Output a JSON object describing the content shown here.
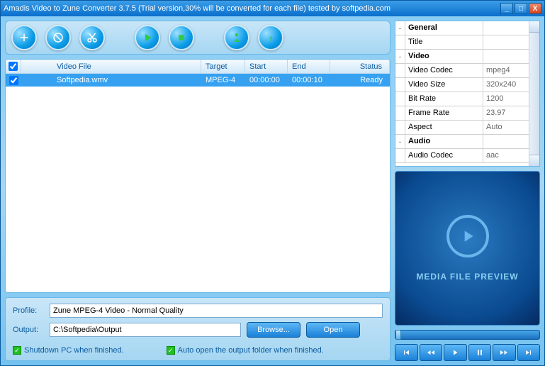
{
  "titlebar": "Amadis Video to Zune Converter 3.7.5 (Trial version,30% will be converted for each file) tested by softpedia.com",
  "list": {
    "headers": {
      "file": "Video File",
      "target": "Target",
      "start": "Start",
      "end": "End",
      "status": "Status"
    },
    "rows": [
      {
        "checked": true,
        "file": "Softpedia.wmv",
        "target": "MPEG-4",
        "start": "00:00:00",
        "end": "00:00:10",
        "status": "Ready"
      }
    ]
  },
  "bottom": {
    "profile_label": "Profile:",
    "profile_value": "Zune MPEG-4 Video - Normal Quality",
    "output_label": "Output:",
    "output_value": "C:\\Softpedia\\Output",
    "browse": "Browse...",
    "open": "Open",
    "chk_shutdown": "Shutdown PC when finished.",
    "chk_autoopen": "Auto open the output folder when finished."
  },
  "props": {
    "groups": [
      {
        "name": "General",
        "items": [
          {
            "k": "Title",
            "v": ""
          }
        ]
      },
      {
        "name": "Video",
        "items": [
          {
            "k": "Video Codec",
            "v": "mpeg4"
          },
          {
            "k": "Video Size",
            "v": "320x240"
          },
          {
            "k": "Bit Rate",
            "v": "1200"
          },
          {
            "k": "Frame Rate",
            "v": "23.97"
          },
          {
            "k": "Aspect",
            "v": "Auto"
          }
        ]
      },
      {
        "name": "Audio",
        "items": [
          {
            "k": "Audio Codec",
            "v": "aac"
          }
        ]
      }
    ]
  },
  "preview_label": "MEDIA FILE PREVIEW"
}
